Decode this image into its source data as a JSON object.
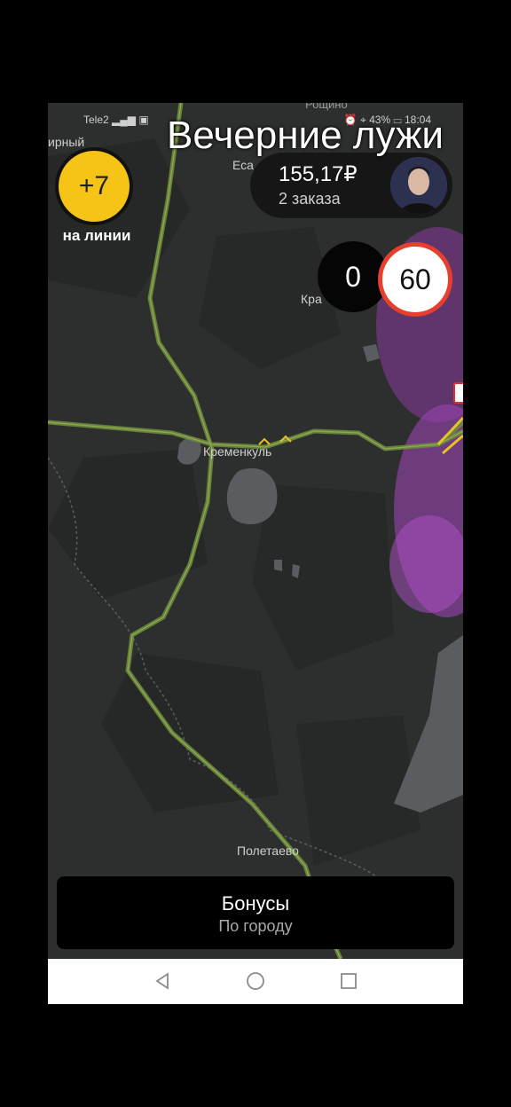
{
  "status_bar": {
    "carrier": "Tele2",
    "battery": "43%",
    "time": "18:04",
    "top_place": "Рощино"
  },
  "overlay_title": "Вечерние лужи",
  "bonus_badge": {
    "value": "+7",
    "label": "на линии"
  },
  "earnings": {
    "amount": "155,17₽",
    "orders": "2 заказа"
  },
  "speed": {
    "current": "0",
    "limit": "60"
  },
  "map_places": {
    "top_left": "ирный",
    "esa": "Еса",
    "kra": "Кра",
    "kremenkul": "Кременкуль",
    "poletaevo": "Полетаево"
  },
  "bonus_panel": {
    "title": "Бонусы",
    "subtitle": "По городу"
  },
  "nav": {
    "back": "back-icon",
    "home": "home-icon",
    "recent": "recent-apps-icon"
  },
  "colors": {
    "accent": "#f6c416",
    "limit_border": "#e63f2e",
    "map_bg": "#2d2f2e",
    "road": "#6e8a3c"
  }
}
